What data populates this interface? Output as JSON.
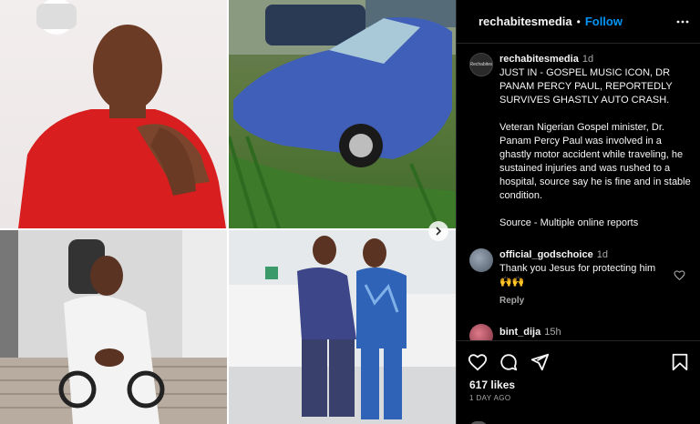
{
  "header": {
    "username": "rechabitesmedia",
    "separator": "•",
    "follow_label": "Follow"
  },
  "post": {
    "author": "rechabitesmedia",
    "author_avatar_text": "Rechabites",
    "time": "1d",
    "caption_headline": "JUST IN - GOSPEL MUSIC ICON, DR PANAM PERCY PAUL, REPORTEDLY SURVIVES GHASTLY AUTO CRASH.",
    "caption_body": "Veteran Nigerian Gospel minister, Dr. Panam Percy Paul was involved in a ghastly motor accident while traveling, he sustained injuries and was rushed to a hospital, source say he is fine and in stable condition.",
    "caption_source": "Source - Multiple online reports"
  },
  "comments": [
    {
      "username": "official_godschoice",
      "time": "1d",
      "text": "Thank you Jesus for protecting him",
      "emoji": "🙌🙌",
      "reply_label": "Reply"
    },
    {
      "username": "bint_dija",
      "time": "15h"
    }
  ],
  "footer": {
    "likes": "617 likes",
    "posted_ago": "1 DAY AGO"
  },
  "icons": {
    "more": "more-horizontal-icon",
    "like": "heart-icon",
    "comment": "comment-icon",
    "share": "send-icon",
    "save": "bookmark-icon",
    "next": "chevron-right-icon"
  },
  "colors": {
    "background": "#000000",
    "accent": "#0095f6",
    "secondary_text": "#a8a8a8",
    "primary_text": "#f5f5f5"
  }
}
